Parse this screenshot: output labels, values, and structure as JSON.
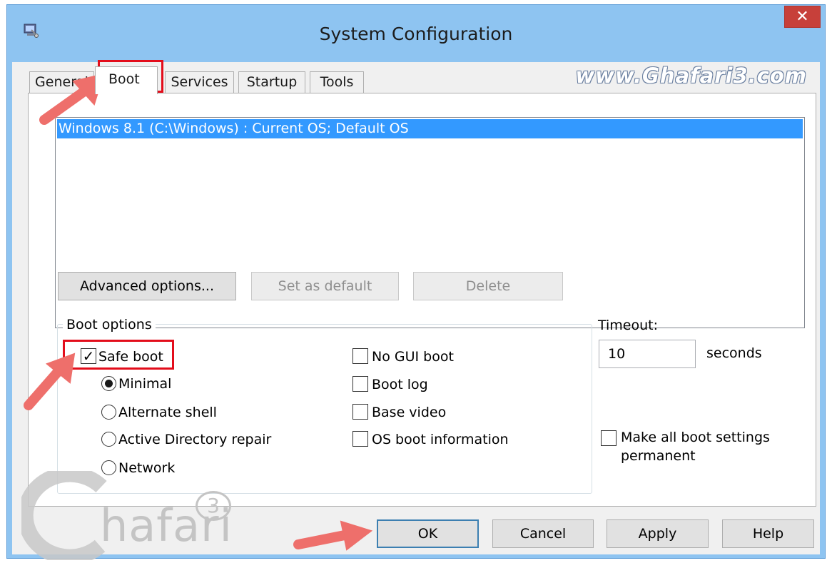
{
  "window": {
    "title": "System Configuration",
    "close_glyph": "✕",
    "icon": "msconfig-icon"
  },
  "watermark": {
    "url": "www.Ghafari3.com",
    "logo_text": "hafari",
    "logo_letter": "G",
    "logo_superscript": "3"
  },
  "tabs": [
    {
      "label": "General",
      "active": false
    },
    {
      "label": "Boot",
      "active": true
    },
    {
      "label": "Services",
      "active": false
    },
    {
      "label": "Startup",
      "active": false
    },
    {
      "label": "Tools",
      "active": false
    }
  ],
  "os_list": {
    "items": [
      "Windows 8.1 (C:\\Windows) : Current OS; Default OS"
    ],
    "selected_index": 0
  },
  "list_buttons": {
    "advanced": "Advanced options...",
    "set_default": "Set as default",
    "delete": "Delete"
  },
  "boot_options": {
    "legend": "Boot options",
    "safe_boot": {
      "label": "Safe boot",
      "checked": true
    },
    "safe_boot_modes": [
      {
        "label": "Minimal",
        "selected": true
      },
      {
        "label": "Alternate shell",
        "selected": false
      },
      {
        "label": "Active Directory repair",
        "selected": false
      },
      {
        "label": "Network",
        "selected": false
      }
    ],
    "flags": [
      {
        "label": "No GUI boot",
        "checked": false
      },
      {
        "label": "Boot log",
        "checked": false
      },
      {
        "label": "Base video",
        "checked": false
      },
      {
        "label": "OS boot information",
        "checked": false
      }
    ]
  },
  "timeout": {
    "label": "Timeout:",
    "value": "10",
    "unit": "seconds"
  },
  "make_permanent": {
    "line1": "Make all boot settings",
    "line2": "permanent",
    "checked": false
  },
  "footer": {
    "ok": "OK",
    "cancel": "Cancel",
    "apply": "Apply",
    "help": "Help"
  },
  "annotations": {
    "highlight_color": "#e30d1b",
    "arrow_color": "#ee6f6b"
  },
  "colors": {
    "titlebar": "#8ec4f1",
    "close_button": "#c7403a",
    "selection": "#3399ff"
  }
}
